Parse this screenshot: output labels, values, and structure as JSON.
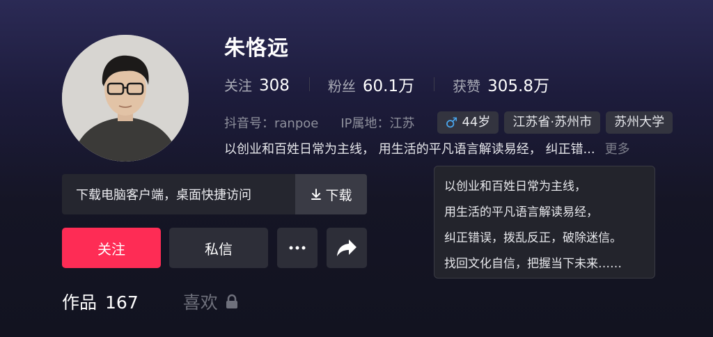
{
  "profile": {
    "name": "朱恪远",
    "stats": [
      {
        "label": "关注",
        "value": "308"
      },
      {
        "label": "粉丝",
        "value": "60.1万"
      },
      {
        "label": "获赞",
        "value": "305.8万"
      }
    ],
    "douyin_id": "抖音号：ranpoe",
    "ip_location": "IP属地：江苏",
    "tags": {
      "age": "44岁",
      "gender_icon": "male-icon",
      "location": "江苏省·苏州市",
      "school": "苏州大学"
    },
    "bio_preview": "以创业和百姓日常为主线， 用生活的平凡语言解读易经， 纠正错...",
    "bio_more": "更多",
    "bio_full": [
      "以创业和百姓日常为主线，",
      "用生活的平凡语言解读易经，",
      "纠正错误，拨乱反正，破除迷信。",
      "找回文化自信，把握当下未来……"
    ]
  },
  "banner": {
    "text": "下载电脑客户端，桌面快捷访问",
    "download_label": "下载",
    "download_icon": "download-icon"
  },
  "actions": {
    "follow_label": "关注",
    "message_label": "私信",
    "more_icon": "ellipsis-icon",
    "share_icon": "share-arrow-icon"
  },
  "tabs": {
    "works_label": "作品",
    "works_count": "167",
    "likes_label": "喜欢",
    "likes_icon": "lock-icon"
  },
  "colors": {
    "accent": "#fe2c55",
    "male": "#4aa8f0"
  }
}
